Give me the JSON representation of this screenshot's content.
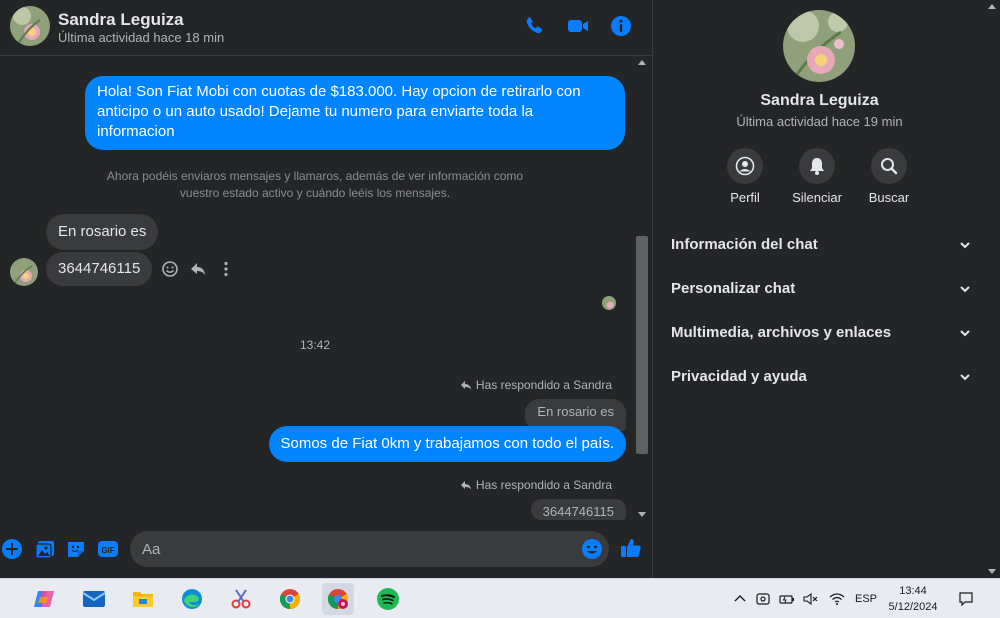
{
  "header": {
    "contact_name": "Sandra Leguiza",
    "status": "Última actividad hace 18 min",
    "icons": [
      "phone-icon",
      "video-icon",
      "info-icon"
    ]
  },
  "messages": {
    "outgoing_1": "Hola! Son Fiat Mobi con cuotas de $183.000. Hay opcion de retirarlo con anticipo o un auto usado! Dejame tu numero para enviarte toda la informacion",
    "notice": "Ahora podéis enviaros mensajes y llamaros, además de ver información como vuestro estado activo y cuándo leéis los mensajes.",
    "incoming_1": "En rosario es",
    "incoming_2": "3644746115",
    "time_separator": "13:42",
    "reply_label_1": "Has respondido a Sandra",
    "quoted_1": "En rosario es",
    "outgoing_2": "Somos de Fiat 0km y trabajamos con todo el país.",
    "reply_label_2": "Has respondido a Sandra",
    "quoted_2": "3644746115"
  },
  "composer": {
    "placeholder": "Aa",
    "icons": [
      "plus-icon",
      "photo-icon",
      "sticker-icon",
      "gif-icon",
      "emoji-icon",
      "like-icon"
    ],
    "gif_text": "GIF"
  },
  "info_panel": {
    "name": "Sandra Leguiza",
    "status": "Última actividad hace 19 min",
    "actions": [
      {
        "label": "Perfil",
        "icon": "profile-icon"
      },
      {
        "label": "Silenciar",
        "icon": "bell-icon"
      },
      {
        "label": "Buscar",
        "icon": "search-icon"
      }
    ],
    "sections": [
      {
        "label": "Información del chat"
      },
      {
        "label": "Personalizar chat"
      },
      {
        "label": "Multimedia, archivos y enlaces"
      },
      {
        "label": "Privacidad y ayuda"
      }
    ]
  },
  "taskbar": {
    "apps": [
      "copilot-icon",
      "mail-icon",
      "file-explorer-icon",
      "edge-icon",
      "snipping-tool-icon",
      "chrome-icon",
      "chrome-profile-icon",
      "spotify-icon"
    ],
    "language": "ESP",
    "time": "13:44",
    "date": "5/12/2024"
  },
  "colors": {
    "accent": "#0084ff",
    "background": "#242526",
    "bubble_in": "#3a3b3c",
    "taskbar": "#e8ecf2"
  }
}
